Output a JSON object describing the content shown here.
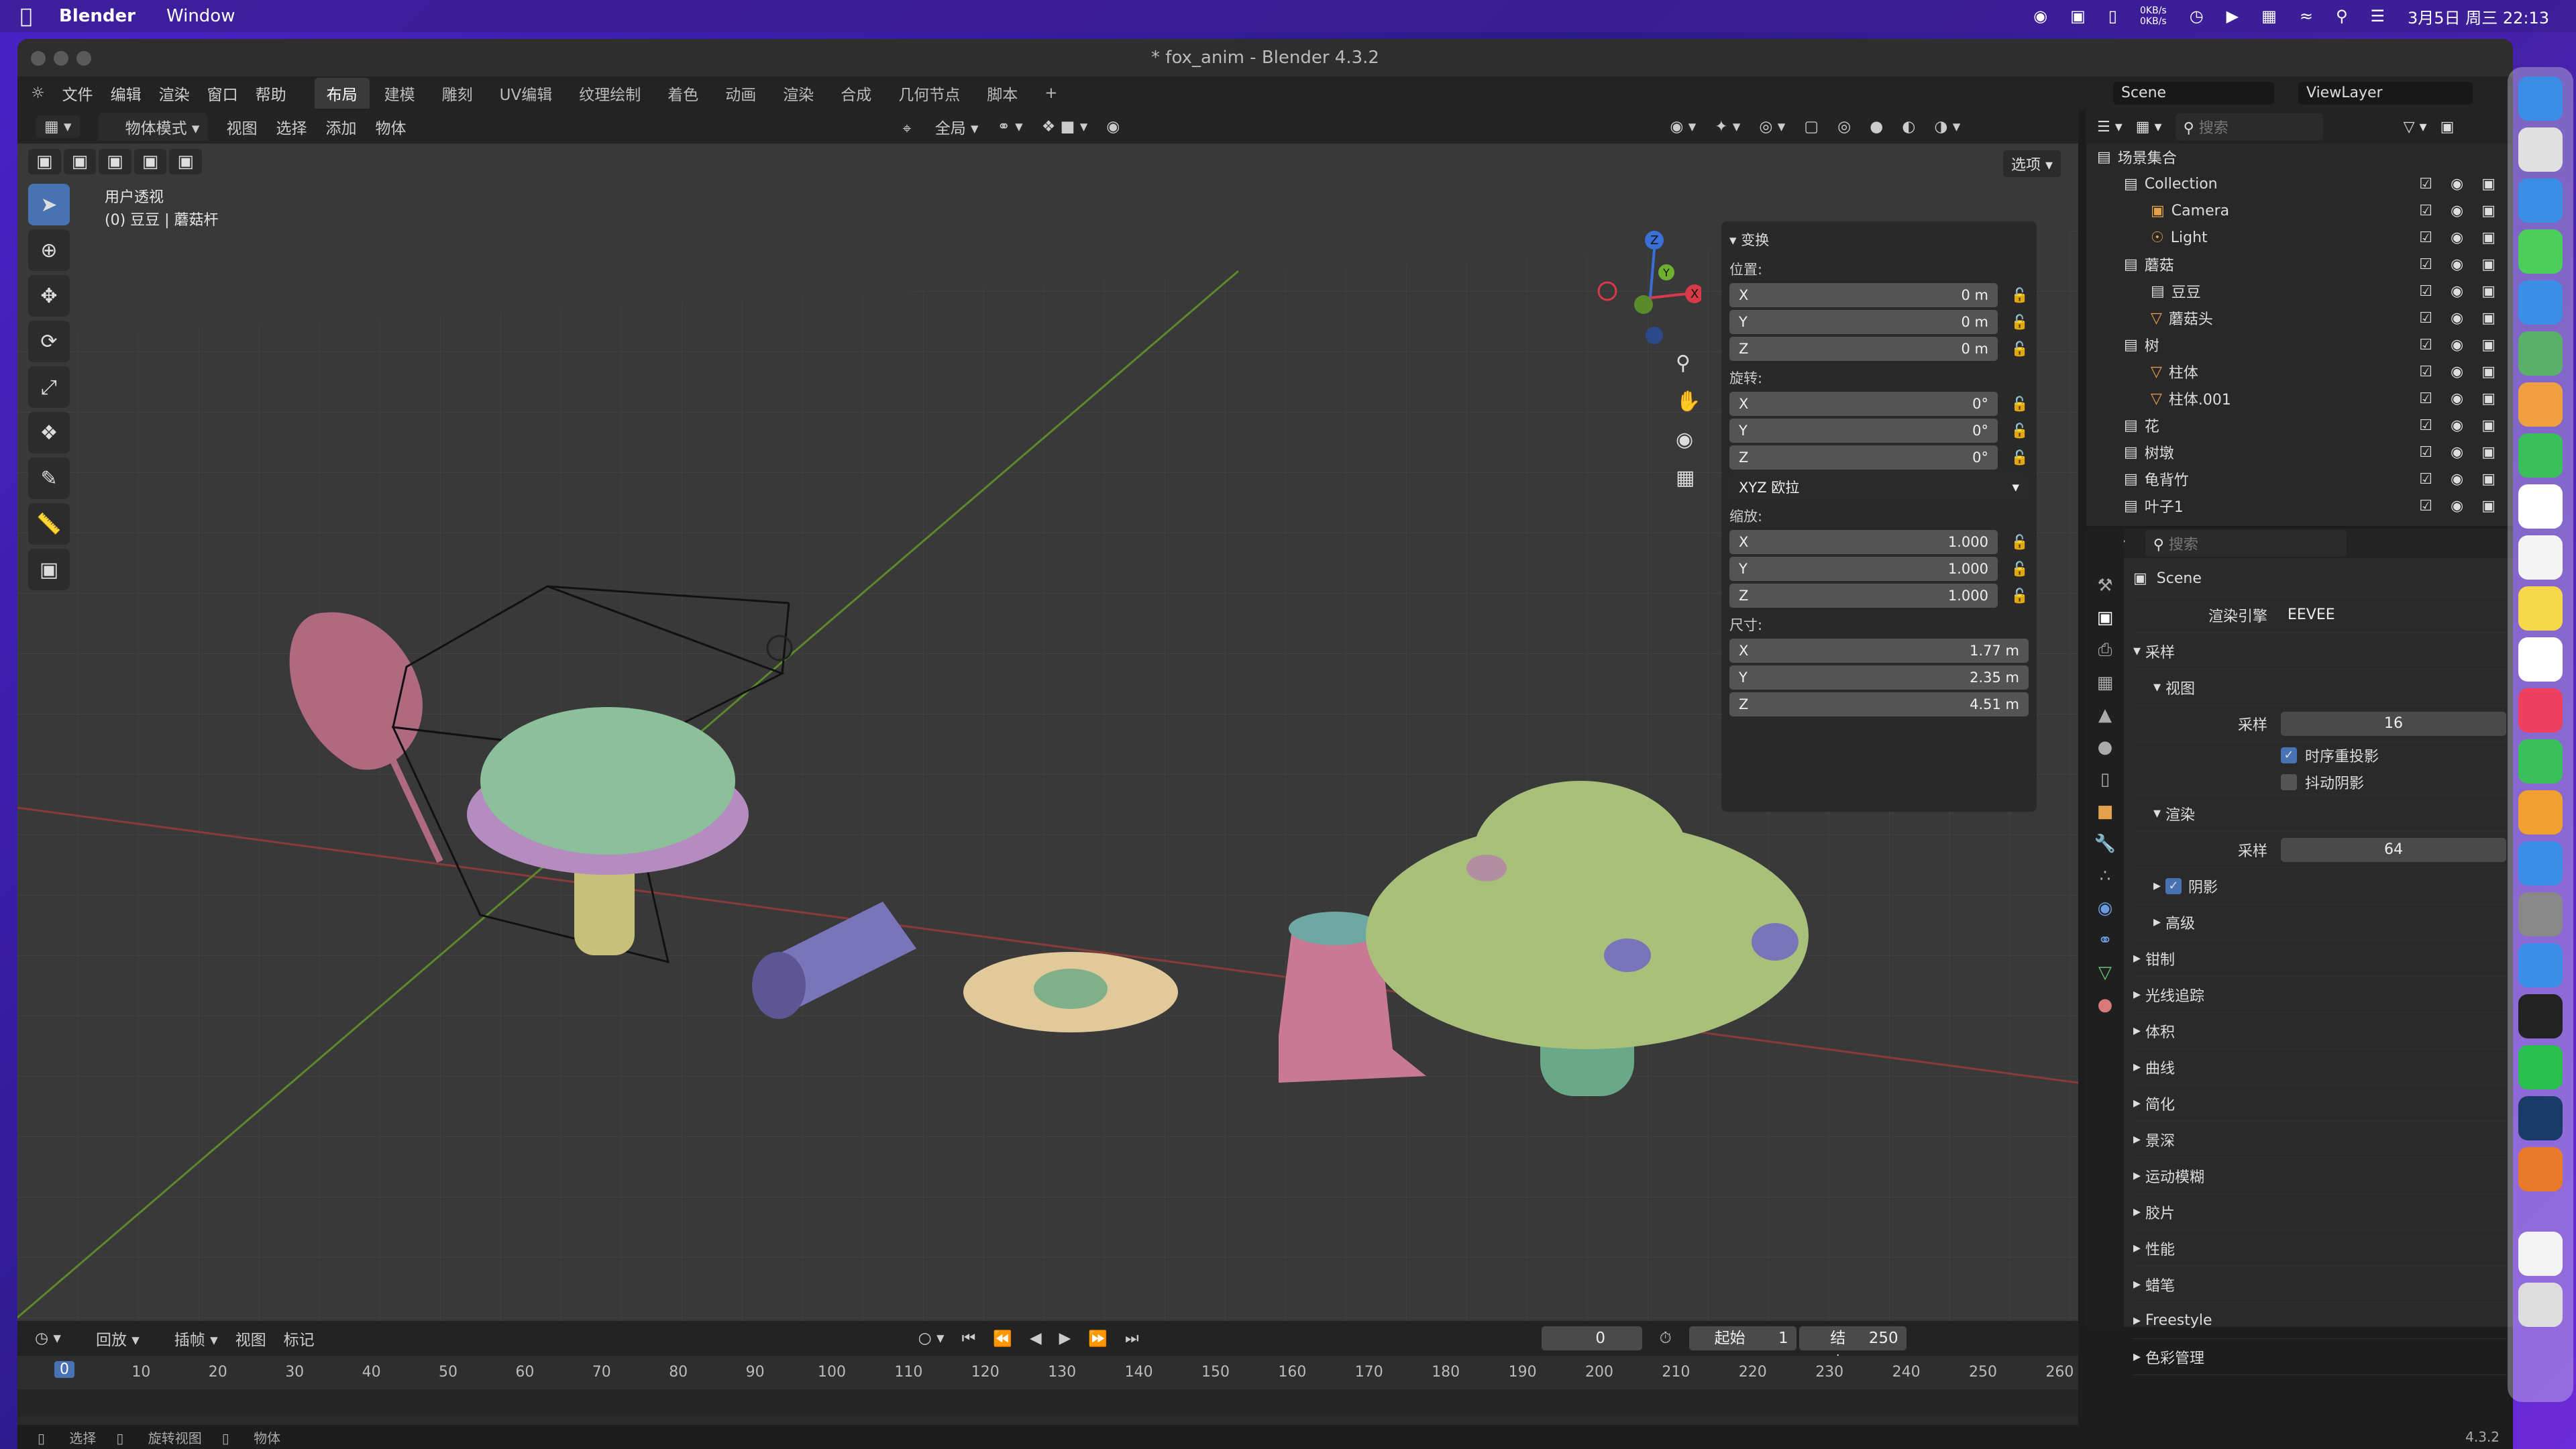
{
  "menubar": {
    "app": "Blender",
    "items": [
      "Window"
    ],
    "netspeed_up": "0KB/s",
    "netspeed_down": "0KB/s",
    "clock": "3月5日 周三 22:13"
  },
  "window": {
    "title": "* fox_anim - Blender 4.3.2"
  },
  "topbar": {
    "menus": [
      "文件",
      "编辑",
      "渲染",
      "窗口",
      "帮助"
    ],
    "workspaces": [
      "布局",
      "建模",
      "雕刻",
      "UV编辑",
      "纹理绘制",
      "着色",
      "动画",
      "渲染",
      "合成",
      "几何节点",
      "脚本"
    ],
    "active_workspace": "布局",
    "scene": "Scene",
    "view_layer": "ViewLayer"
  },
  "viewport": {
    "mode": "物体模式",
    "menus": [
      "视图",
      "选择",
      "添加",
      "物体"
    ],
    "orientation": "全局",
    "options": "选项",
    "info_line1": "用户透视",
    "info_line2": "(0) 豆豆 | 蘑菇杆"
  },
  "transform": {
    "header": "变换",
    "location_label": "位置:",
    "location": {
      "x": "0 m",
      "y": "0 m",
      "z": "0 m"
    },
    "rotation_label": "旋转:",
    "rotation": {
      "x": "0°",
      "y": "0°",
      "z": "0°"
    },
    "rotation_mode": "XYZ 欧拉",
    "scale_label": "缩放:",
    "scale": {
      "x": "1.000",
      "y": "1.000",
      "z": "1.000"
    },
    "dimensions_label": "尺寸:",
    "dimensions": {
      "x": "1.77 m",
      "y": "2.35 m",
      "z": "4.51 m"
    }
  },
  "outliner": {
    "search_placeholder": "搜索",
    "rows": [
      {
        "label": "场景集合",
        "icon": "scene-collection",
        "depth": 0
      },
      {
        "label": "Collection",
        "icon": "collection",
        "depth": 1
      },
      {
        "label": "Camera",
        "icon": "camera",
        "depth": 2
      },
      {
        "label": "Light",
        "icon": "light",
        "depth": 2
      },
      {
        "label": "蘑菇",
        "icon": "collection",
        "depth": 1
      },
      {
        "label": "豆豆",
        "icon": "collection",
        "depth": 2
      },
      {
        "label": "蘑菇头",
        "icon": "mesh",
        "depth": 2
      },
      {
        "label": "树",
        "icon": "collection",
        "depth": 1
      },
      {
        "label": "柱体",
        "icon": "mesh",
        "depth": 2
      },
      {
        "label": "柱体.001",
        "icon": "mesh",
        "depth": 2
      },
      {
        "label": "花",
        "icon": "collection",
        "depth": 1
      },
      {
        "label": "树墩",
        "icon": "collection",
        "depth": 1
      },
      {
        "label": "龟背竹",
        "icon": "collection",
        "depth": 1
      },
      {
        "label": "叶子1",
        "icon": "collection",
        "depth": 1
      }
    ]
  },
  "properties": {
    "search_placeholder": "搜索",
    "scene": "Scene",
    "render_engine_label": "渲染引擎",
    "render_engine": "EEVEE",
    "sampling": "采样",
    "viewport": "视图",
    "samples_label": "采样",
    "viewport_samples": "16",
    "temporal_reprojection": "时序重投影",
    "jitter_shadows": "抖动阴影",
    "render": "渲染",
    "render_samples": "64",
    "shadows": "阴影",
    "advanced": "高级",
    "sections": [
      "钳制",
      "光线追踪",
      "体积",
      "曲线",
      "简化",
      "景深",
      "运动模糊",
      "胶片",
      "性能",
      "蜡笔",
      "Freestyle",
      "色彩管理"
    ]
  },
  "timeline": {
    "menus": [
      "回放",
      "插帧",
      "视图",
      "标记"
    ],
    "current_frame": "0",
    "start_label": "起始",
    "start": "1",
    "end_label": "结束",
    "end": "250",
    "ticks": [
      "0",
      "10",
      "20",
      "30",
      "40",
      "50",
      "60",
      "70",
      "80",
      "90",
      "100",
      "110",
      "120",
      "130",
      "140",
      "150",
      "160",
      "170",
      "180",
      "190",
      "200",
      "210",
      "220",
      "230",
      "240",
      "250",
      "260"
    ]
  },
  "statusbar": {
    "items": [
      "选择",
      "旋转视图",
      "物体"
    ],
    "version": "4.3.2"
  },
  "colors": {
    "accent": "#4772b3",
    "object_orange": "#e4a04a",
    "viewport_bg": "#393939"
  }
}
